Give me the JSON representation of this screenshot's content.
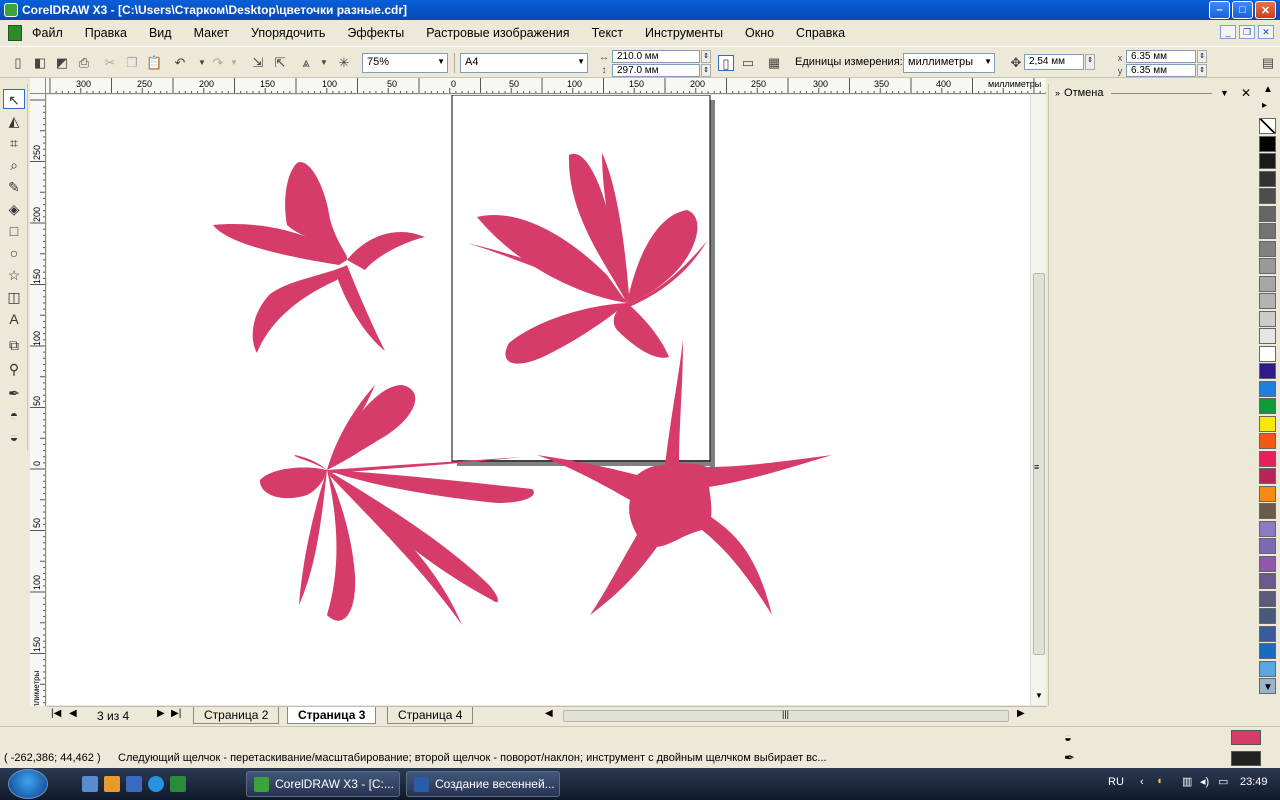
{
  "window": {
    "title": "CorelDRAW X3 - [C:\\Users\\Старком\\Desktop\\цветочки разные.cdr]"
  },
  "menu": [
    "Файл",
    "Правка",
    "Вид",
    "Макет",
    "Упорядочить",
    "Эффекты",
    "Растровые изображения",
    "Текст",
    "Инструменты",
    "Окно",
    "Справка"
  ],
  "toolbar": {
    "zoom": "75%",
    "paper": "A4",
    "width": "210.0 мм",
    "height": "297.0 мм",
    "units_label": "Единицы измерения:",
    "units": "миллиметры",
    "nudge": "2,54 мм",
    "dup_x": "6.35 мм",
    "dup_y": "6.35 мм"
  },
  "ruler": {
    "unit": "миллиметры",
    "top_ticks": [
      "300",
      "250",
      "200",
      "150",
      "100",
      "50",
      "0",
      "50",
      "100",
      "150",
      "200",
      "250",
      "300",
      "350",
      "400"
    ],
    "left_ticks": [
      "250",
      "200",
      "150",
      "100",
      "50",
      "0",
      "50",
      "100",
      "150"
    ],
    "left_unit": "миллиметры"
  },
  "docker": {
    "title": "Отмена"
  },
  "palette": [
    "#ffffff",
    "#000000",
    "#1a1a1a",
    "#333333",
    "#4d4d4d",
    "#666666",
    "#737373",
    "#808080",
    "#999999",
    "#a6a6a6",
    "#b3b3b3",
    "#cccccc",
    "#e6e6e6",
    "#ffffff",
    "#2e1a8a",
    "#1f7fdc",
    "#119a3a",
    "#f7e80a",
    "#f05a14",
    "#e8205a",
    "#b8245a",
    "#f28c14",
    "#6b5a4a",
    "#8a7ac8",
    "#7a6ab4",
    "#8c5aa8",
    "#6a5a8a",
    "#5a5a7a",
    "#4a5a7a",
    "#3a5a9a",
    "#1a6abf",
    "#5aa6e0",
    "#9ab4cc"
  ],
  "pages": {
    "counter": "3 из 4",
    "tabs": [
      "Страница 2",
      "Страница 3",
      "Страница 4"
    ],
    "active": 1
  },
  "status": {
    "coords": "( -262,386; 44,462 )",
    "hint": "Следующий щелчок - перетаскивание/масштабирование; второй щелчок - поворот/наклон; инструмент с двойным щелчком выбирает вс...",
    "fill_color": "#d63c6a",
    "outline_color": "#222222"
  },
  "shape_color": "#d63c6a",
  "taskbar": {
    "tasks": [
      "CorelDRAW X3 - [C:...",
      "Создание весенней..."
    ],
    "lang": "RU",
    "clock": "23:49"
  }
}
